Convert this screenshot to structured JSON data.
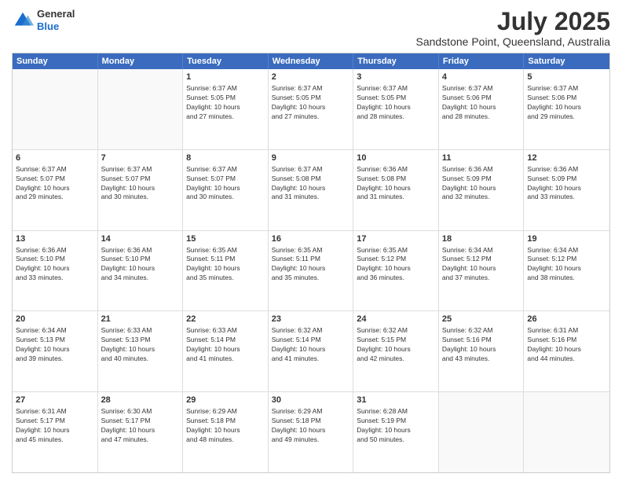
{
  "header": {
    "logo_line1": "General",
    "logo_line2": "Blue",
    "title": "July 2025",
    "subtitle": "Sandstone Point, Queensland, Australia"
  },
  "calendar": {
    "days_of_week": [
      "Sunday",
      "Monday",
      "Tuesday",
      "Wednesday",
      "Thursday",
      "Friday",
      "Saturday"
    ],
    "weeks": [
      [
        {
          "day": "",
          "info": ""
        },
        {
          "day": "",
          "info": ""
        },
        {
          "day": "1",
          "info": "Sunrise: 6:37 AM\nSunset: 5:05 PM\nDaylight: 10 hours\nand 27 minutes."
        },
        {
          "day": "2",
          "info": "Sunrise: 6:37 AM\nSunset: 5:05 PM\nDaylight: 10 hours\nand 27 minutes."
        },
        {
          "day": "3",
          "info": "Sunrise: 6:37 AM\nSunset: 5:05 PM\nDaylight: 10 hours\nand 28 minutes."
        },
        {
          "day": "4",
          "info": "Sunrise: 6:37 AM\nSunset: 5:06 PM\nDaylight: 10 hours\nand 28 minutes."
        },
        {
          "day": "5",
          "info": "Sunrise: 6:37 AM\nSunset: 5:06 PM\nDaylight: 10 hours\nand 29 minutes."
        }
      ],
      [
        {
          "day": "6",
          "info": "Sunrise: 6:37 AM\nSunset: 5:07 PM\nDaylight: 10 hours\nand 29 minutes."
        },
        {
          "day": "7",
          "info": "Sunrise: 6:37 AM\nSunset: 5:07 PM\nDaylight: 10 hours\nand 30 minutes."
        },
        {
          "day": "8",
          "info": "Sunrise: 6:37 AM\nSunset: 5:07 PM\nDaylight: 10 hours\nand 30 minutes."
        },
        {
          "day": "9",
          "info": "Sunrise: 6:37 AM\nSunset: 5:08 PM\nDaylight: 10 hours\nand 31 minutes."
        },
        {
          "day": "10",
          "info": "Sunrise: 6:36 AM\nSunset: 5:08 PM\nDaylight: 10 hours\nand 31 minutes."
        },
        {
          "day": "11",
          "info": "Sunrise: 6:36 AM\nSunset: 5:09 PM\nDaylight: 10 hours\nand 32 minutes."
        },
        {
          "day": "12",
          "info": "Sunrise: 6:36 AM\nSunset: 5:09 PM\nDaylight: 10 hours\nand 33 minutes."
        }
      ],
      [
        {
          "day": "13",
          "info": "Sunrise: 6:36 AM\nSunset: 5:10 PM\nDaylight: 10 hours\nand 33 minutes."
        },
        {
          "day": "14",
          "info": "Sunrise: 6:36 AM\nSunset: 5:10 PM\nDaylight: 10 hours\nand 34 minutes."
        },
        {
          "day": "15",
          "info": "Sunrise: 6:35 AM\nSunset: 5:11 PM\nDaylight: 10 hours\nand 35 minutes."
        },
        {
          "day": "16",
          "info": "Sunrise: 6:35 AM\nSunset: 5:11 PM\nDaylight: 10 hours\nand 35 minutes."
        },
        {
          "day": "17",
          "info": "Sunrise: 6:35 AM\nSunset: 5:12 PM\nDaylight: 10 hours\nand 36 minutes."
        },
        {
          "day": "18",
          "info": "Sunrise: 6:34 AM\nSunset: 5:12 PM\nDaylight: 10 hours\nand 37 minutes."
        },
        {
          "day": "19",
          "info": "Sunrise: 6:34 AM\nSunset: 5:12 PM\nDaylight: 10 hours\nand 38 minutes."
        }
      ],
      [
        {
          "day": "20",
          "info": "Sunrise: 6:34 AM\nSunset: 5:13 PM\nDaylight: 10 hours\nand 39 minutes."
        },
        {
          "day": "21",
          "info": "Sunrise: 6:33 AM\nSunset: 5:13 PM\nDaylight: 10 hours\nand 40 minutes."
        },
        {
          "day": "22",
          "info": "Sunrise: 6:33 AM\nSunset: 5:14 PM\nDaylight: 10 hours\nand 41 minutes."
        },
        {
          "day": "23",
          "info": "Sunrise: 6:32 AM\nSunset: 5:14 PM\nDaylight: 10 hours\nand 41 minutes."
        },
        {
          "day": "24",
          "info": "Sunrise: 6:32 AM\nSunset: 5:15 PM\nDaylight: 10 hours\nand 42 minutes."
        },
        {
          "day": "25",
          "info": "Sunrise: 6:32 AM\nSunset: 5:16 PM\nDaylight: 10 hours\nand 43 minutes."
        },
        {
          "day": "26",
          "info": "Sunrise: 6:31 AM\nSunset: 5:16 PM\nDaylight: 10 hours\nand 44 minutes."
        }
      ],
      [
        {
          "day": "27",
          "info": "Sunrise: 6:31 AM\nSunset: 5:17 PM\nDaylight: 10 hours\nand 45 minutes."
        },
        {
          "day": "28",
          "info": "Sunrise: 6:30 AM\nSunset: 5:17 PM\nDaylight: 10 hours\nand 47 minutes."
        },
        {
          "day": "29",
          "info": "Sunrise: 6:29 AM\nSunset: 5:18 PM\nDaylight: 10 hours\nand 48 minutes."
        },
        {
          "day": "30",
          "info": "Sunrise: 6:29 AM\nSunset: 5:18 PM\nDaylight: 10 hours\nand 49 minutes."
        },
        {
          "day": "31",
          "info": "Sunrise: 6:28 AM\nSunset: 5:19 PM\nDaylight: 10 hours\nand 50 minutes."
        },
        {
          "day": "",
          "info": ""
        },
        {
          "day": "",
          "info": ""
        }
      ]
    ]
  }
}
